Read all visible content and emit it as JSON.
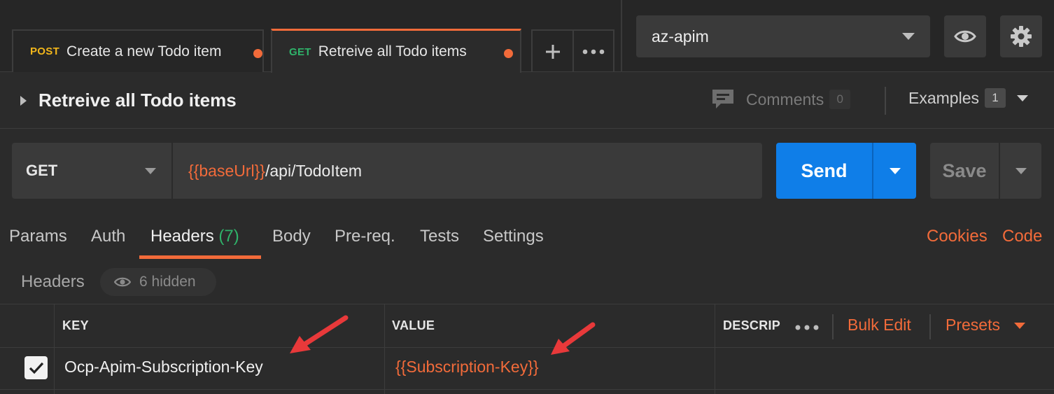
{
  "tabs": [
    {
      "method": "POST",
      "label": "Create a new Todo item",
      "unsaved": true,
      "active": false
    },
    {
      "method": "GET",
      "label": "Retreive all Todo items",
      "unsaved": true,
      "active": true
    }
  ],
  "tab_controls": {
    "new_tab_icon": "plus-icon",
    "more_icon": "ellipsis-icon"
  },
  "environment": {
    "selected": "az-apim"
  },
  "env_buttons": {
    "quick_look_icon": "eye-icon",
    "settings_icon": "gear-icon"
  },
  "request": {
    "title": "Retreive all Todo items",
    "comments_label": "Comments",
    "comments_count": "0",
    "examples_label": "Examples",
    "examples_count": "1",
    "method": "GET",
    "url_var": "{{baseUrl}}",
    "url_path": "/api/TodoItem"
  },
  "actions": {
    "send": "Send",
    "save": "Save"
  },
  "subtabs": {
    "params": "Params",
    "auth": "Auth",
    "headers": "Headers",
    "headers_count": "(7)",
    "body": "Body",
    "prereq": "Pre-req.",
    "tests": "Tests",
    "settings": "Settings",
    "cookies": "Cookies",
    "code": "Code"
  },
  "headers_section": {
    "label": "Headers",
    "hidden": "6 hidden"
  },
  "table": {
    "columns": {
      "key": "KEY",
      "value": "VALUE",
      "description": "DESCRIP"
    },
    "bulk_edit": "Bulk Edit",
    "presets": "Presets",
    "rows": [
      {
        "checked": true,
        "key": "Ocp-Apim-Subscription-Key",
        "value": "{{Subscription-Key}}"
      }
    ]
  },
  "colors": {
    "accent": "#f26b3a",
    "send_blue": "#0f7ee8",
    "get_green": "#2fb36a",
    "post_yellow": "#f2b61b",
    "annotation_red": "#e8393a"
  }
}
